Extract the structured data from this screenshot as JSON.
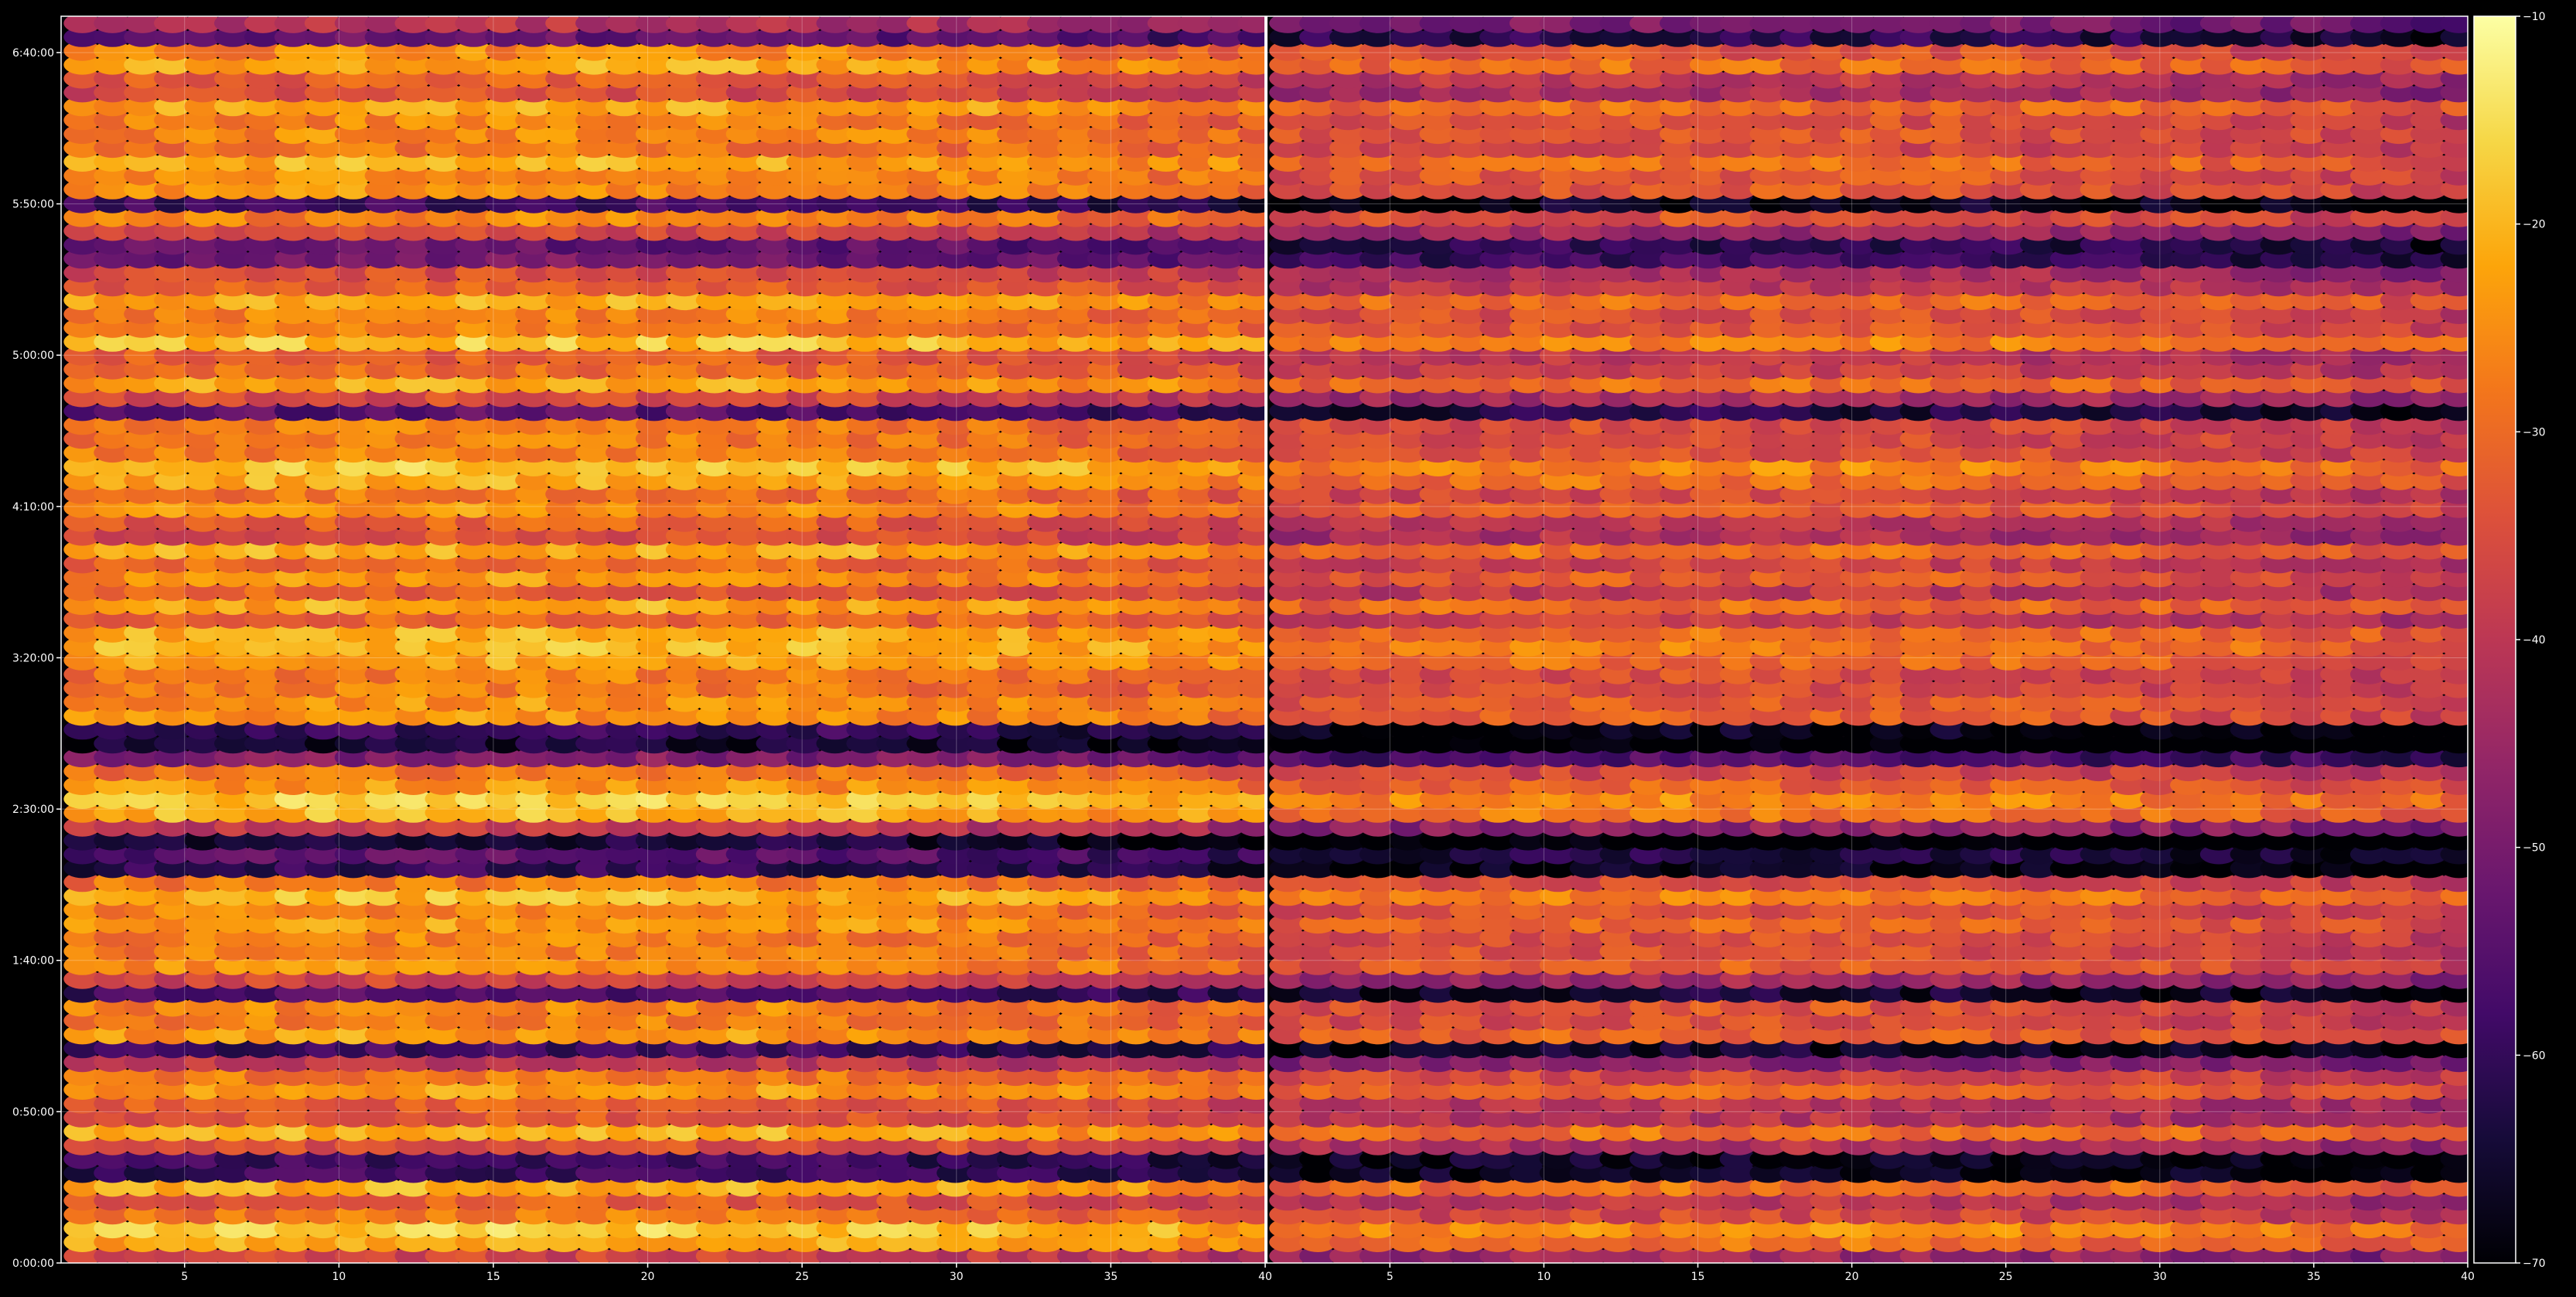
{
  "chart_data": {
    "type": "heatmap",
    "title": "",
    "xlabel": "",
    "ylabel": "",
    "panels": [
      {
        "name": "",
        "x_range": [
          1,
          40
        ],
        "x_ticks": [
          {
            "value": 5,
            "label": "5"
          },
          {
            "value": 10,
            "label": "10"
          },
          {
            "value": 15,
            "label": "15"
          },
          {
            "value": 20,
            "label": "20"
          },
          {
            "value": 25,
            "label": "25"
          },
          {
            "value": 30,
            "label": "30"
          },
          {
            "value": 35,
            "label": "35"
          },
          {
            "value": 40,
            "label": "40"
          }
        ]
      },
      {
        "name": "",
        "x_range": [
          1,
          40
        ],
        "x_ticks": [
          {
            "value": 5,
            "label": "5"
          },
          {
            "value": 10,
            "label": "10"
          },
          {
            "value": 15,
            "label": "15"
          },
          {
            "value": 20,
            "label": "20"
          },
          {
            "value": 25,
            "label": "25"
          },
          {
            "value": 30,
            "label": "30"
          },
          {
            "value": 35,
            "label": "35"
          },
          {
            "value": 40,
            "label": "40"
          }
        ]
      }
    ],
    "y_axis": {
      "unit": "seconds",
      "range": [
        0,
        24720
      ],
      "ticks": [
        {
          "value": 0,
          "label": "0:00:00"
        },
        {
          "value": 3000,
          "label": "0:50:00"
        },
        {
          "value": 6000,
          "label": "1:40:00"
        },
        {
          "value": 9000,
          "label": "2:30:00"
        },
        {
          "value": 12000,
          "label": "3:20:00"
        },
        {
          "value": 15000,
          "label": "4:10:00"
        },
        {
          "value": 18000,
          "label": "5:00:00"
        },
        {
          "value": 21000,
          "label": "5:50:00"
        },
        {
          "value": 24000,
          "label": "6:40:00"
        }
      ]
    },
    "grid": true,
    "colorbar": {
      "colormap": "inferno",
      "range": [
        -70,
        -10
      ],
      "ticks": [
        {
          "value": -10,
          "label": "−10"
        },
        {
          "value": -20,
          "label": "−20"
        },
        {
          "value": -30,
          "label": "−30"
        },
        {
          "value": -40,
          "label": "−40"
        },
        {
          "value": -50,
          "label": "−50"
        },
        {
          "value": -60,
          "label": "−60"
        },
        {
          "value": -70,
          "label": "−70"
        }
      ],
      "placement": "right"
    },
    "row_profile": {
      "note_free": true,
      "rows_per_panel": 90,
      "cols_per_panel": 40,
      "bright_rows_seconds": [
        480,
        720,
        1500,
        2400,
        2640,
        3360,
        3600,
        4560,
        4680,
        5160,
        5760,
        6000,
        6360,
        6600,
        7200,
        7560,
        8880,
        9000,
        9240,
        9600,
        10800,
        11040,
        11520,
        11880,
        12240,
        12480,
        12960,
        13680,
        14160,
        15120,
        15480,
        15840,
        16200,
        16680,
        17040,
        17400,
        18240,
        18480,
        18720,
        19080,
        19560,
        20640,
        21240,
        21600,
        21960,
        22560,
        22920,
        23760,
        24120
      ],
      "dark_rows_seconds": [
        1800,
        2100,
        4200,
        5400,
        7800,
        8160,
        8400,
        10200,
        10320,
        10560,
        16920,
        19800,
        20040,
        20280,
        21000,
        24360
      ],
      "panel_mean_dB": [
        -33,
        -41
      ]
    }
  }
}
